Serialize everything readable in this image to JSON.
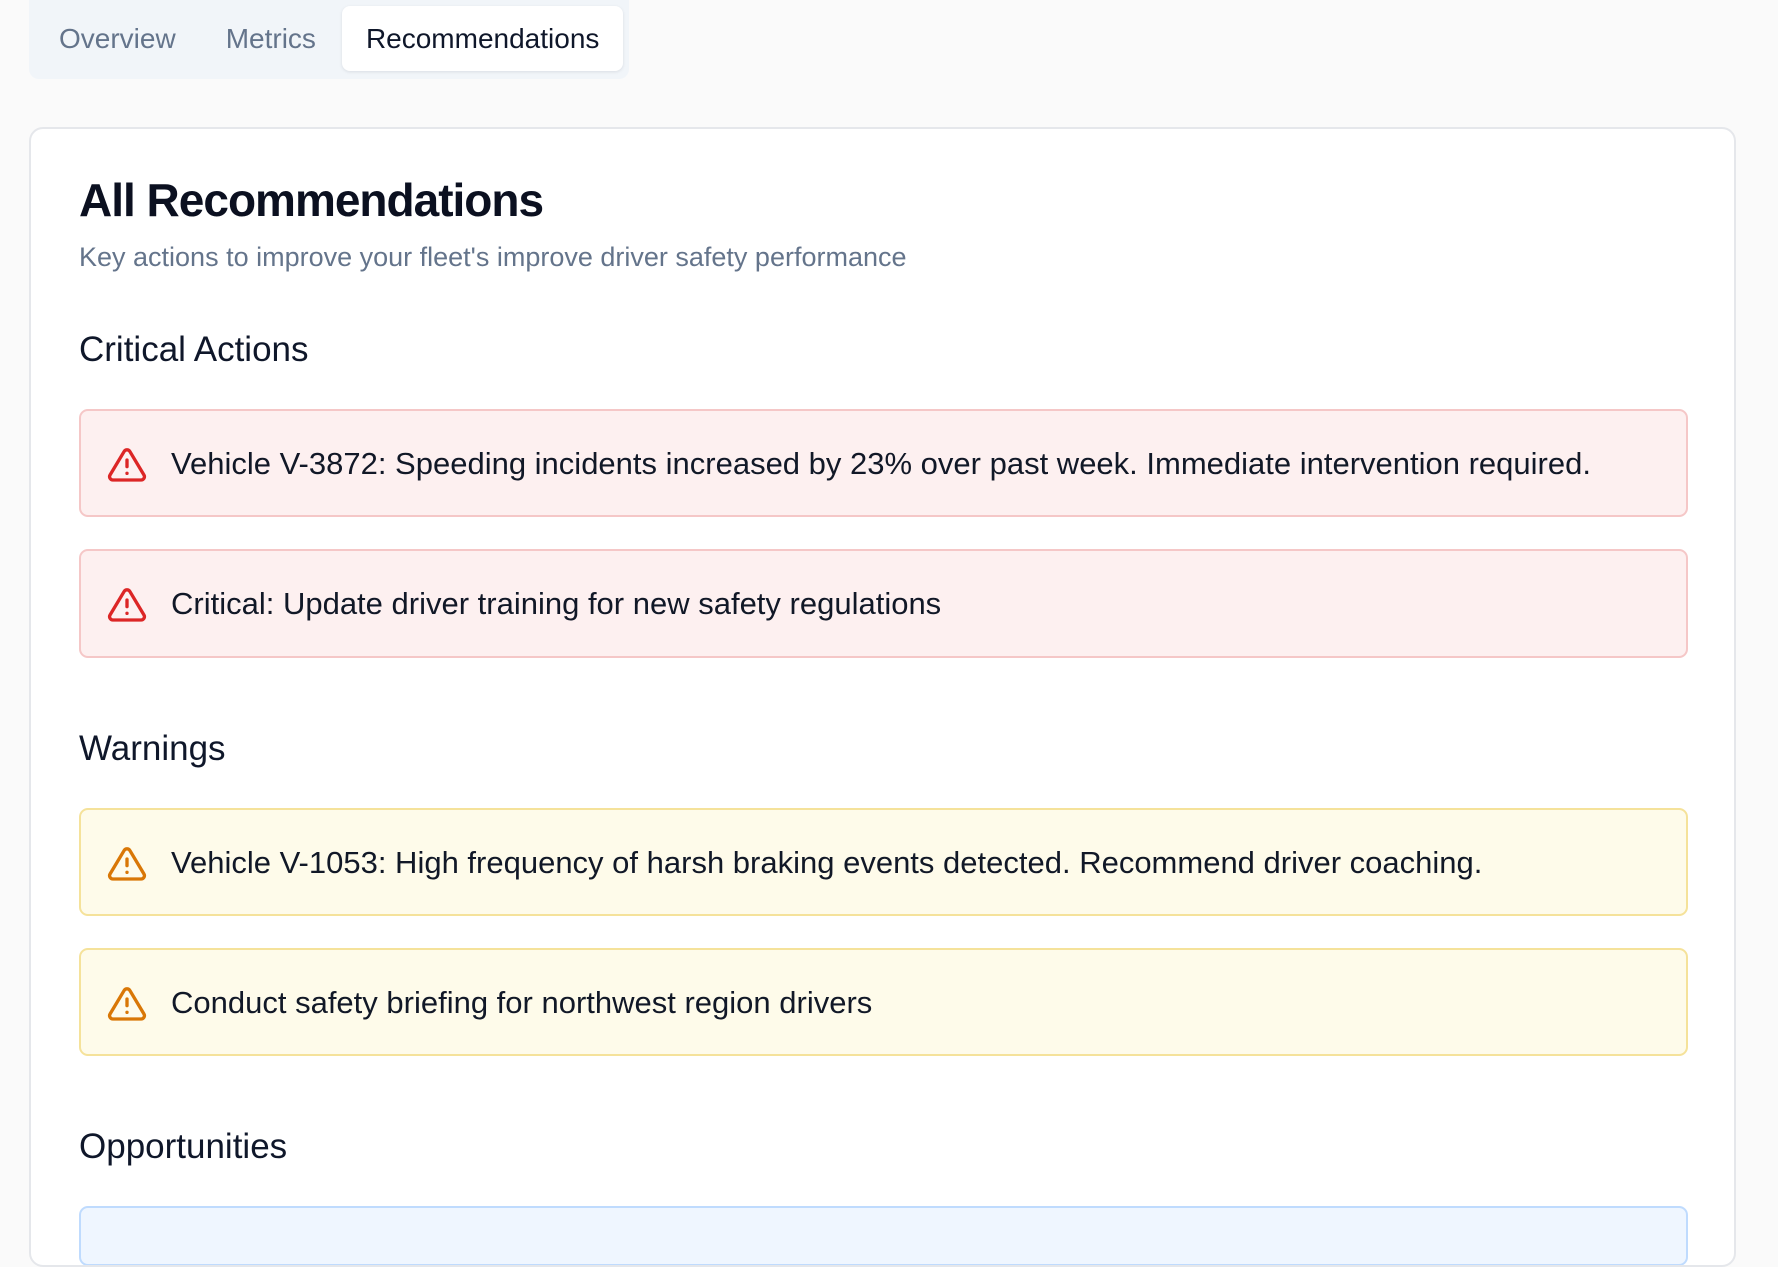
{
  "tabs": [
    {
      "label": "Overview",
      "active": false
    },
    {
      "label": "Metrics",
      "active": false
    },
    {
      "label": "Recommendations",
      "active": true
    }
  ],
  "card": {
    "title": "All Recommendations",
    "subtitle": "Key actions to improve your fleet's improve driver safety performance"
  },
  "sections": {
    "critical": {
      "title": "Critical Actions",
      "items": [
        {
          "icon": "alert-triangle-icon",
          "text": "Vehicle V-3872: Speeding incidents increased by 23% over past week. Immediate intervention required."
        },
        {
          "icon": "alert-triangle-icon",
          "text": "Critical: Update driver training for new safety regulations"
        }
      ]
    },
    "warnings": {
      "title": "Warnings",
      "items": [
        {
          "icon": "alert-triangle-icon",
          "text": "Vehicle V-1053: High frequency of harsh braking events detected. Recommend driver coaching."
        },
        {
          "icon": "alert-triangle-icon",
          "text": "Conduct safety briefing for northwest region drivers"
        }
      ]
    },
    "opportunities": {
      "title": "Opportunities"
    }
  },
  "colors": {
    "critical_icon": "#dc2626",
    "critical_bg": "#fdf0f0",
    "warning_icon": "#d97706",
    "warning_bg": "#fefbea",
    "opportunity_bg": "#eff6ff"
  }
}
